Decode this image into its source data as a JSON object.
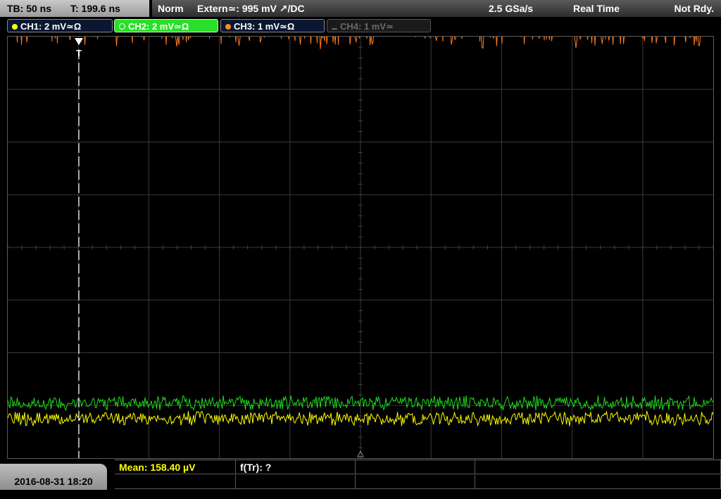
{
  "header": {
    "timebase": "TB: 50 ns",
    "trigger_time": "T: 199.6 ns",
    "mode": "Norm",
    "trigger_source": "Extern≃: 995 mV ↗/DC",
    "sample_rate": "2.5 GSa/s",
    "acq_mode": "Real Time",
    "status": "Not Rdy."
  },
  "channels": [
    {
      "label": "CH1: 2 mV≃Ω",
      "color": "#ffff00",
      "state": "on"
    },
    {
      "label": "CH2: 2 mV≃Ω",
      "color": "#22ee22",
      "state": "selected"
    },
    {
      "label": "CH3: 1 mV≃Ω",
      "color": "#ff8c1a",
      "state": "on"
    },
    {
      "label": "CH4: 1 mV≃",
      "color": "#777777",
      "state": "off"
    }
  ],
  "screen": {
    "trigger_marker": "T",
    "traces": [
      {
        "channel": "CH3",
        "color": "#ff7a1a",
        "level_div": 4.2,
        "noise_div": 0.35
      },
      {
        "channel": "CH2",
        "color": "#1edc1e",
        "level_div": -2.95,
        "noise_div": 0.12
      },
      {
        "channel": "CH1",
        "color": "#ffff00",
        "level_div": -3.25,
        "noise_div": 0.12
      }
    ]
  },
  "footer": {
    "datetime": "2016-08-31 18:20",
    "measurements": [
      {
        "label": "Mean: 158.40 µV",
        "color": "#ffff00"
      },
      {
        "label": "f(Tr): ?",
        "color": "#ffffff"
      },
      {
        "label": "",
        "color": "#ffffff"
      },
      {
        "label": "",
        "color": "#ffffff"
      },
      {
        "label": "",
        "color": "#ffffff"
      },
      {
        "label": "",
        "color": "#ffffff"
      },
      {
        "label": "",
        "color": "#ffffff"
      },
      {
        "label": "",
        "color": "#ffffff"
      }
    ]
  }
}
